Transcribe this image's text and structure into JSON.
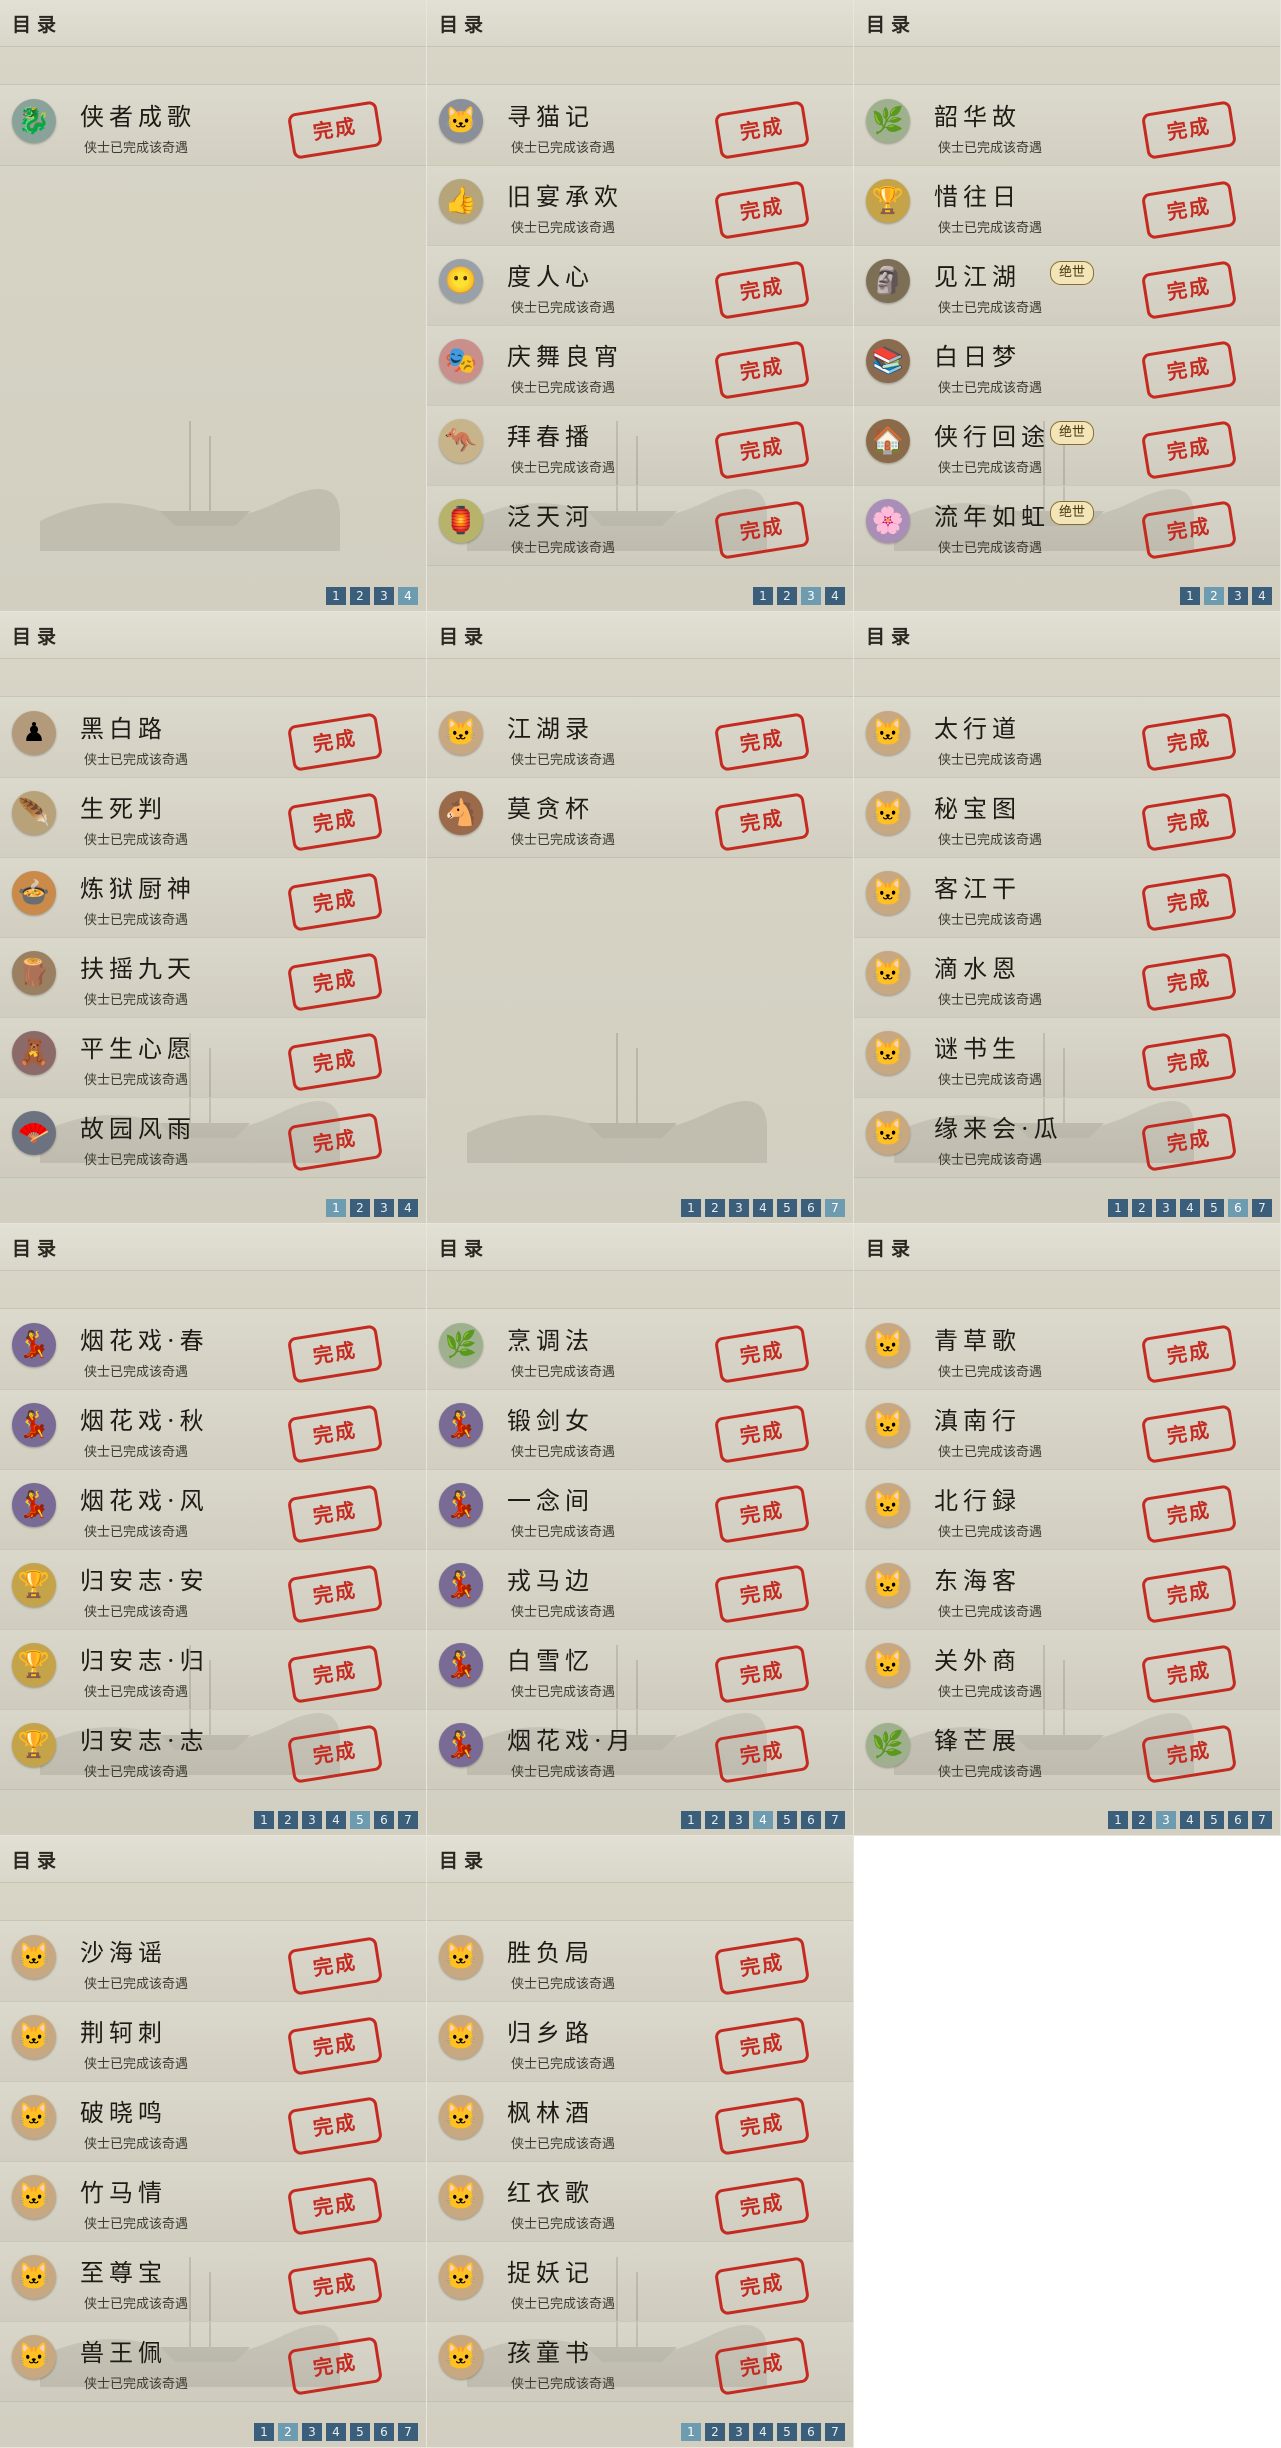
{
  "header_title": "目录",
  "status_text": "侠士已完成该奇遇",
  "seal_text": "完成",
  "badge_text": "绝世",
  "panels": [
    {
      "items": [
        {
          "name": "侠者成歌",
          "icon": "🐉",
          "bg": "#8aa39a"
        }
      ],
      "pages": [
        "1",
        "2",
        "3",
        "4"
      ],
      "active": "4"
    },
    {
      "items": [
        {
          "name": "寻猫记",
          "icon": "🐱",
          "bg": "#8a8f99"
        },
        {
          "name": "旧宴承欢",
          "icon": "👍",
          "bg": "#b6a47a"
        },
        {
          "name": "度人心",
          "icon": "😶",
          "bg": "#9aa0a8"
        },
        {
          "name": "庆舞良宵",
          "icon": "🎭",
          "bg": "#c98f8a"
        },
        {
          "name": "拜春播",
          "icon": "🦘",
          "bg": "#c8b48a"
        },
        {
          "name": "泛天河",
          "icon": "🏮",
          "bg": "#b7b36a"
        }
      ],
      "pages": [
        "1",
        "2",
        "3",
        "4"
      ],
      "active": "3"
    },
    {
      "items": [
        {
          "name": "韶华故",
          "icon": "🌿",
          "bg": "#9fb08e"
        },
        {
          "name": "惜往日",
          "icon": "🏆",
          "bg": "#c5a449"
        },
        {
          "name": "见江湖",
          "icon": "🗿",
          "bg": "#7c6f55",
          "badge": true
        },
        {
          "name": "白日梦",
          "icon": "📚",
          "bg": "#8a6b50"
        },
        {
          "name": "侠行回途",
          "icon": "🏠",
          "bg": "#8b6a4a",
          "badge": true
        },
        {
          "name": "流年如虹",
          "icon": "🌸",
          "bg": "#a98fb8",
          "badge": true
        }
      ],
      "pages": [
        "1",
        "2",
        "3",
        "4"
      ],
      "active": "2"
    },
    {
      "items": [
        {
          "name": "黑白路",
          "icon": "♟",
          "bg": "#b39a7a"
        },
        {
          "name": "生死判",
          "icon": "🪶",
          "bg": "#b8a27a"
        },
        {
          "name": "炼狱厨神",
          "icon": "🍲",
          "bg": "#c98a4a"
        },
        {
          "name": "扶摇九天",
          "icon": "🪵",
          "bg": "#9a8060"
        },
        {
          "name": "平生心愿",
          "icon": "🧸",
          "bg": "#8c6a6a"
        },
        {
          "name": "故园风雨",
          "icon": "🪭",
          "bg": "#6d7280"
        }
      ],
      "pages": [
        "1",
        "2",
        "3",
        "4"
      ],
      "active": "1"
    },
    {
      "items": [
        {
          "name": "江湖录",
          "icon": "🐱",
          "bg": "#c8a880"
        },
        {
          "name": "莫贪杯",
          "icon": "🐴",
          "bg": "#9a6a4a"
        }
      ],
      "pages": [
        "1",
        "2",
        "3",
        "4",
        "5",
        "6",
        "7"
      ],
      "active": "7"
    },
    {
      "items": [
        {
          "name": "太行道",
          "icon": "🐱",
          "bg": "#c8a880"
        },
        {
          "name": "秘宝图",
          "icon": "🐱",
          "bg": "#c8a880"
        },
        {
          "name": "客江干",
          "icon": "🐱",
          "bg": "#c8a880"
        },
        {
          "name": "滴水恩",
          "icon": "🐱",
          "bg": "#c8a880"
        },
        {
          "name": "谜书生",
          "icon": "🐱",
          "bg": "#c8a880"
        },
        {
          "name": "缘来会·瓜",
          "icon": "🐱",
          "bg": "#c8a880"
        }
      ],
      "pages": [
        "1",
        "2",
        "3",
        "4",
        "5",
        "6",
        "7"
      ],
      "active": "6"
    },
    {
      "items": [
        {
          "name": "烟花戏·春",
          "icon": "💃",
          "bg": "#7a6a96"
        },
        {
          "name": "烟花戏·秋",
          "icon": "💃",
          "bg": "#7a6a96"
        },
        {
          "name": "烟花戏·风",
          "icon": "💃",
          "bg": "#7a6a96"
        },
        {
          "name": "归安志·安",
          "icon": "🏆",
          "bg": "#c5a449"
        },
        {
          "name": "归安志·归",
          "icon": "🏆",
          "bg": "#c5a449"
        },
        {
          "name": "归安志·志",
          "icon": "🏆",
          "bg": "#c5a449"
        }
      ],
      "pages": [
        "1",
        "2",
        "3",
        "4",
        "5",
        "6",
        "7"
      ],
      "active": "5"
    },
    {
      "items": [
        {
          "name": "烹调法",
          "icon": "🌿",
          "bg": "#9fb08e"
        },
        {
          "name": "锻剑女",
          "icon": "💃",
          "bg": "#7a6a96"
        },
        {
          "name": "一念间",
          "icon": "💃",
          "bg": "#7a6a96"
        },
        {
          "name": "戎马边",
          "icon": "💃",
          "bg": "#7a6a96"
        },
        {
          "name": "白雪忆",
          "icon": "💃",
          "bg": "#7a6a96"
        },
        {
          "name": "烟花戏·月",
          "icon": "💃",
          "bg": "#7a6a96"
        }
      ],
      "pages": [
        "1",
        "2",
        "3",
        "4",
        "5",
        "6",
        "7"
      ],
      "active": "4"
    },
    {
      "items": [
        {
          "name": "青草歌",
          "icon": "🐱",
          "bg": "#c8a880"
        },
        {
          "name": "滇南行",
          "icon": "🐱",
          "bg": "#c8a880"
        },
        {
          "name": "北行録",
          "icon": "🐱",
          "bg": "#c8a880"
        },
        {
          "name": "东海客",
          "icon": "🐱",
          "bg": "#c8a880"
        },
        {
          "name": "关外商",
          "icon": "🐱",
          "bg": "#c8a880"
        },
        {
          "name": "锋芒展",
          "icon": "🌿",
          "bg": "#9fb08e"
        }
      ],
      "pages": [
        "1",
        "2",
        "3",
        "4",
        "5",
        "6",
        "7"
      ],
      "active": "3"
    },
    {
      "items": [
        {
          "name": "沙海谣",
          "icon": "🐱",
          "bg": "#c8a880"
        },
        {
          "name": "荆轲刺",
          "icon": "🐱",
          "bg": "#c8a880"
        },
        {
          "name": "破晓鸣",
          "icon": "🐱",
          "bg": "#c8a880"
        },
        {
          "name": "竹马情",
          "icon": "🐱",
          "bg": "#c8a880"
        },
        {
          "name": "至尊宝",
          "icon": "🐱",
          "bg": "#c8a880"
        },
        {
          "name": "兽王佩",
          "icon": "🐱",
          "bg": "#c8a880"
        }
      ],
      "pages": [
        "1",
        "2",
        "3",
        "4",
        "5",
        "6",
        "7"
      ],
      "active": "2"
    },
    {
      "items": [
        {
          "name": "胜负局",
          "icon": "🐱",
          "bg": "#c8a880"
        },
        {
          "name": "归乡路",
          "icon": "🐱",
          "bg": "#c8a880"
        },
        {
          "name": "枫林酒",
          "icon": "🐱",
          "bg": "#c8a880"
        },
        {
          "name": "红衣歌",
          "icon": "🐱",
          "bg": "#c8a880"
        },
        {
          "name": "捉妖记",
          "icon": "🐱",
          "bg": "#c8a880"
        },
        {
          "name": "孩童书",
          "icon": "🐱",
          "bg": "#c8a880"
        }
      ],
      "pages": [
        "1",
        "2",
        "3",
        "4",
        "5",
        "6",
        "7"
      ],
      "active": "1"
    }
  ]
}
